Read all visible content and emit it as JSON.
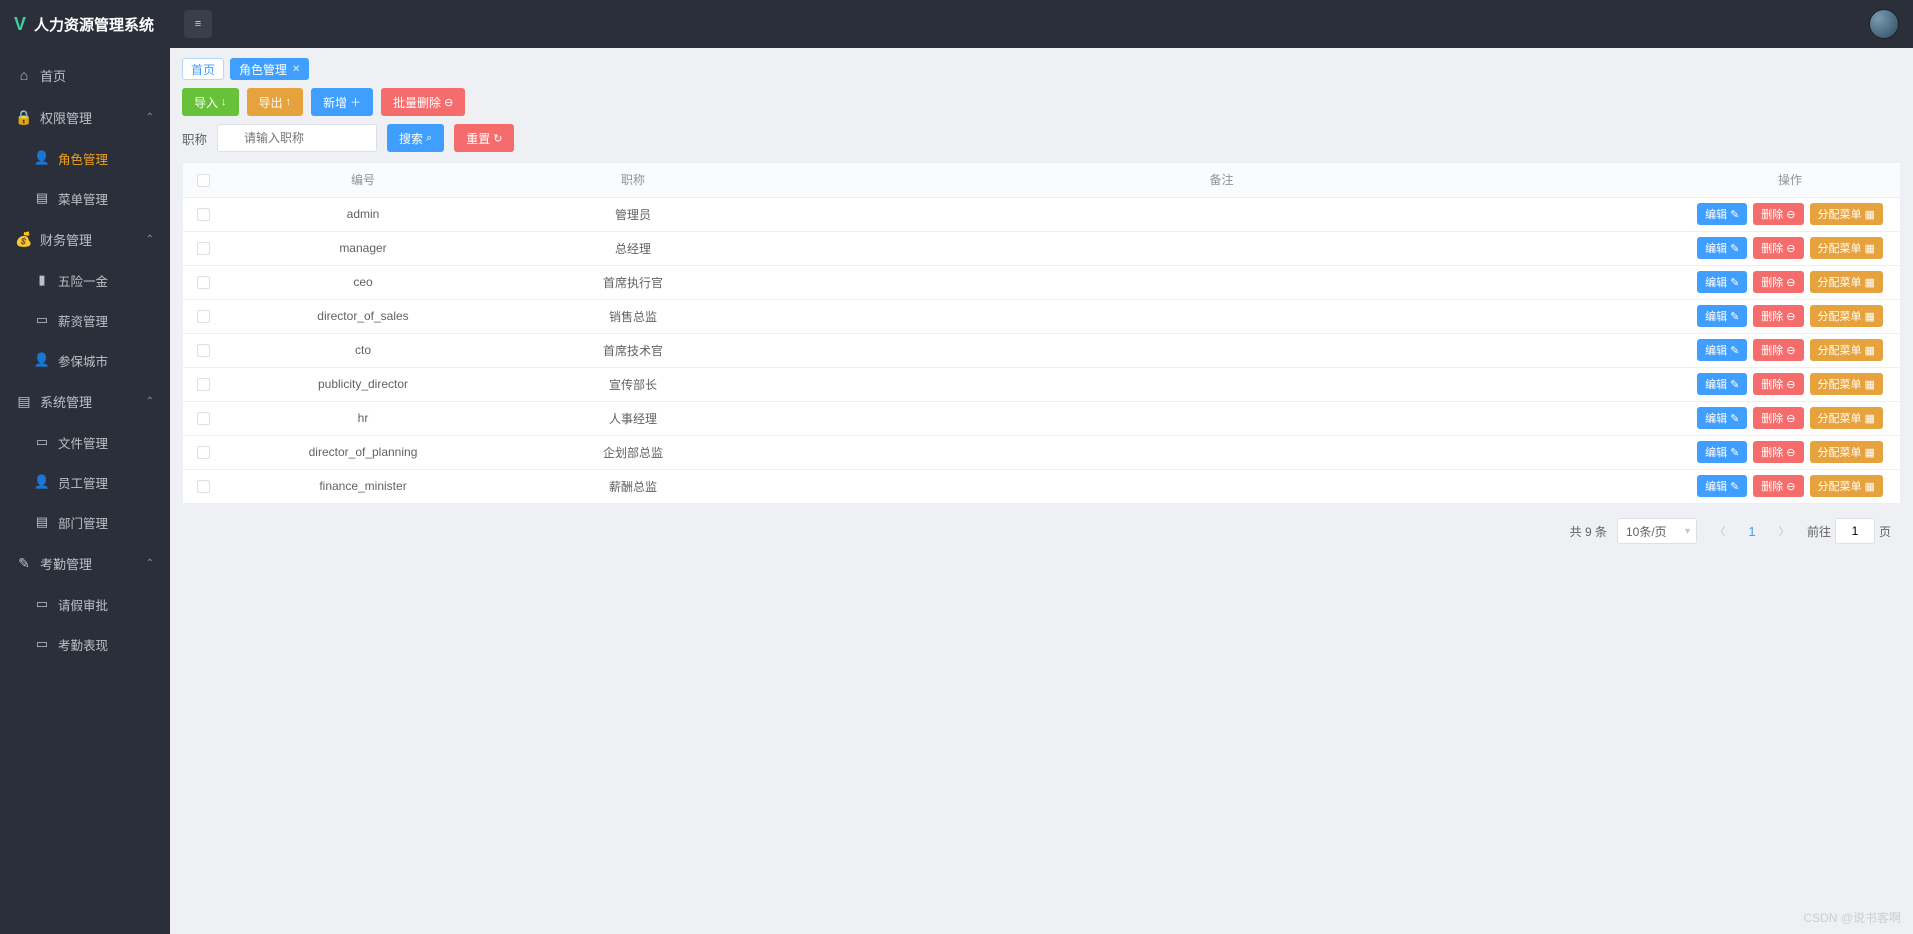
{
  "brand": {
    "logo": "V",
    "title": "人力资源管理系统"
  },
  "sidebar": {
    "home_label": "首页",
    "groups": [
      {
        "label": "权限管理",
        "items": [
          {
            "label": "角色管理",
            "active": true
          },
          {
            "label": "菜单管理",
            "active": false
          }
        ]
      },
      {
        "label": "财务管理",
        "items": [
          {
            "label": "五险一金",
            "active": false
          },
          {
            "label": "薪资管理",
            "active": false
          },
          {
            "label": "参保城市",
            "active": false
          }
        ]
      },
      {
        "label": "系统管理",
        "items": [
          {
            "label": "文件管理",
            "active": false
          },
          {
            "label": "员工管理",
            "active": false
          },
          {
            "label": "部门管理",
            "active": false
          }
        ]
      },
      {
        "label": "考勤管理",
        "items": [
          {
            "label": "请假审批",
            "active": false
          },
          {
            "label": "考勤表现",
            "active": false
          }
        ]
      }
    ]
  },
  "tabs": {
    "home": "首页",
    "active": "角色管理"
  },
  "toolbar": {
    "import_label": "导入",
    "export_label": "导出",
    "add_label": "新增",
    "batch_delete_label": "批量删除"
  },
  "filter": {
    "label": "职称",
    "placeholder": "请输入职称",
    "search_label": "搜索",
    "reset_label": "重置"
  },
  "table": {
    "columns": {
      "code": "编号",
      "title": "职称",
      "remark": "备注",
      "ops": "操作"
    },
    "ops": {
      "edit": "编辑",
      "delete": "删除",
      "assign": "分配菜单"
    },
    "rows": [
      {
        "code": "admin",
        "title": "管理员",
        "remark": ""
      },
      {
        "code": "manager",
        "title": "总经理",
        "remark": ""
      },
      {
        "code": "ceo",
        "title": "首席执行官",
        "remark": ""
      },
      {
        "code": "director_of_sales",
        "title": "销售总监",
        "remark": ""
      },
      {
        "code": "cto",
        "title": "首席技术官",
        "remark": ""
      },
      {
        "code": "publicity_director",
        "title": "宣传部长",
        "remark": ""
      },
      {
        "code": "hr",
        "title": "人事经理",
        "remark": ""
      },
      {
        "code": "director_of_planning",
        "title": "企划部总监",
        "remark": ""
      },
      {
        "code": "finance_minister",
        "title": "薪酬总监",
        "remark": ""
      }
    ]
  },
  "pagination": {
    "total_text": "共 9 条",
    "page_size": "10条/页",
    "current_page": "1",
    "jump_prefix": "前往",
    "jump_value": "1",
    "jump_suffix": "页"
  },
  "watermark": "CSDN @说书客啊"
}
